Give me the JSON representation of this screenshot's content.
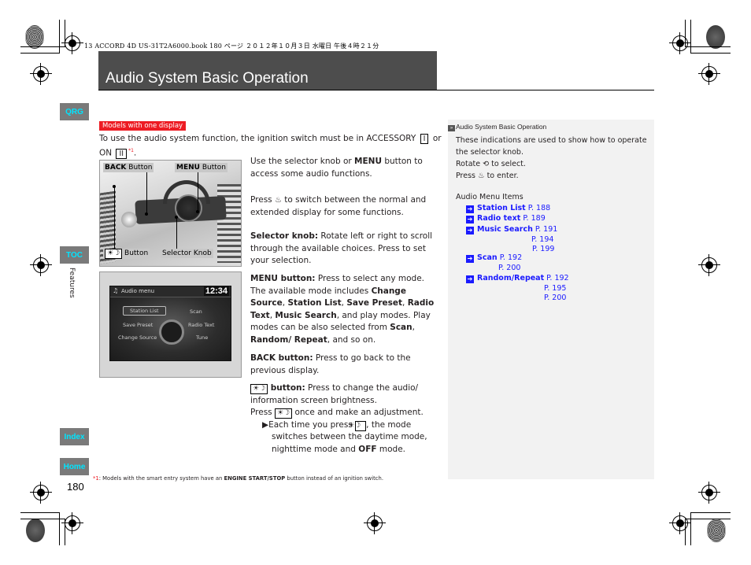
{
  "print_header": "13 ACCORD 4D US-31T2A6000.book  180 ページ  ２０１２年１０月３日  水曜日  午後４時２１分",
  "page": {
    "title": "Audio System Basic Operation",
    "number": "180",
    "section": "Features"
  },
  "side_nav": {
    "qrg": "QRG",
    "toc": "TOC",
    "index": "Index",
    "home": "Home"
  },
  "model_tag": "Models with one display",
  "intro": {
    "text_a": "To use the audio system function, the ignition switch must be in ACCESSORY",
    "box1": "I",
    "text_b": "or ON",
    "box2": "II",
    "footnote_ref": "*1",
    "end": "."
  },
  "photo1": {
    "back_label_bold": "BACK",
    "back_label": "Button",
    "menu_label_bold": "MENU",
    "menu_label": "Button",
    "dim_label": "Button",
    "dim_icon": "☀☽",
    "knob_label": "Selector Knob"
  },
  "photo2": {
    "screen_title": "Audio menu",
    "clock": "12:34",
    "items": [
      "Station List",
      "Scan",
      "Save Preset",
      "Radio Text",
      "Change Source",
      "Tune"
    ]
  },
  "body": {
    "p1_a": "Use the selector knob or ",
    "p1_b": "MENU",
    "p1_c": " button to access some audio functions.",
    "p2_a": "Press ",
    "p2_icon": "♨",
    "p2_b": " to switch between the normal and extended display for some functions.",
    "p3_label": "Selector knob:",
    "p3_text": " Rotate left or right to scroll through the available choices. Press to set your selection.",
    "p4_label": "MENU button:",
    "p4_text_a": " Press to select any mode. The available mode includes ",
    "p4_b1": "Change Source",
    "p4_sep1": ", ",
    "p4_b2": "Station List",
    "p4_sep2": ", ",
    "p4_b3": "Save Preset",
    "p4_sep3": ", ",
    "p4_b4": "Radio Text",
    "p4_sep4": ", ",
    "p4_b5": "Music Search",
    "p4_text_b": ", and play modes. Play modes can be also selected from ",
    "p4_b6": "Scan",
    "p4_sep5": ", ",
    "p4_b7": "Random/ Repeat",
    "p4_text_c": ", and so on.",
    "p5_label": "BACK button:",
    "p5_text": " Press to go back to the previous display.",
    "p6_icon": "☀☽",
    "p6_label": " button:",
    "p6_text": " Press to change the audio/ information screen brightness.",
    "p7_a": "Press ",
    "p7_icon": "☀☽",
    "p7_b": " once and make an adjustment.",
    "p8_bullet": "▶",
    "p8_a": "Each time you press ",
    "p8_icon": "☀☽",
    "p8_b": ", the mode switches between the daytime mode, nighttime mode and ",
    "p8_bold": "OFF",
    "p8_c": " mode."
  },
  "sidebar": {
    "heading": "Audio System Basic Operation",
    "line1": "These indications are used to show how to operate the selector knob.",
    "rotate_a": "Rotate ",
    "rotate_icon": "⟲",
    "rotate_b": " to select.",
    "press_a": "Press ",
    "press_icon": "♨",
    "press_b": " to enter.",
    "subheading": "Audio Menu Items",
    "links": [
      {
        "label": "Station List",
        "pages": [
          "P. 188"
        ]
      },
      {
        "label": "Radio text",
        "pages": [
          "P. 189"
        ]
      },
      {
        "label": "Music Search",
        "pages": [
          "P. 191",
          "P. 194",
          "P. 199"
        ]
      },
      {
        "label": "Scan",
        "pages": [
          "P. 192",
          "P. 200"
        ]
      },
      {
        "label": "Random/Repeat",
        "pages": [
          "P. 192",
          "P. 195",
          "P. 200"
        ]
      }
    ]
  },
  "footnote": {
    "ref": "*1",
    "text_a": ": Models with the smart entry system have an ",
    "bold": "ENGINE START/STOP",
    "text_b": "  button instead of an ignition switch."
  },
  "colors": {
    "title_bar": "#4d4d4d",
    "tag_red": "#ed1c24",
    "nav_tab_bg": "#7a7a7a",
    "nav_tab_text": "#00e5ff",
    "link_blue": "#1a1aff",
    "sidebar_bg": "#f2f2f2"
  }
}
